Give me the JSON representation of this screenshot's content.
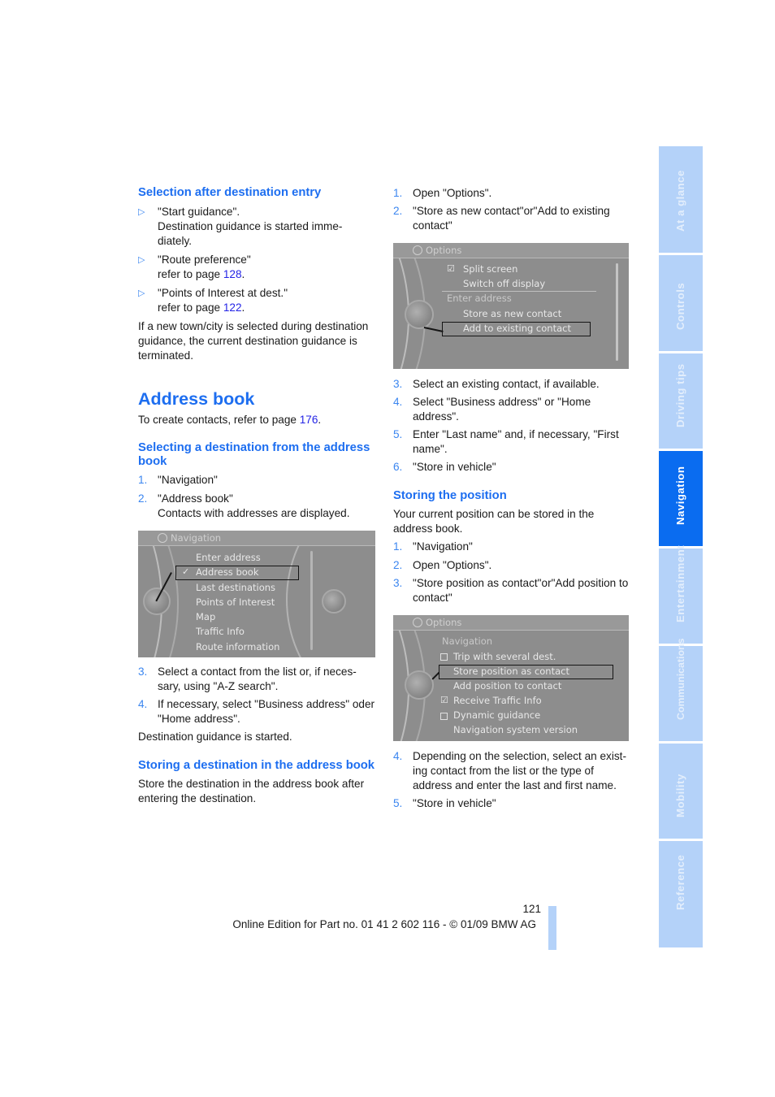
{
  "left_column": {
    "selection_heading": "Selection after destination entry",
    "bullets": [
      {
        "marker": "▷",
        "line1": "\"Start guidance\".",
        "line2": "Destination guidance is started imme-",
        "line3": "diately."
      },
      {
        "marker": "▷",
        "line1": "\"Route preference\"",
        "ref_prefix": "refer to page ",
        "ref_page": "128",
        "ref_suffix": "."
      },
      {
        "marker": "▷",
        "line1": "\"Points of Interest at dest.\"",
        "ref_prefix": "refer to page ",
        "ref_page": "122",
        "ref_suffix": "."
      }
    ],
    "selection_note": "If a new town/city is selected during destination guidance, the current destination guidance is terminated.",
    "address_book_title": "Address book",
    "create_contacts_prefix": "To create contacts, refer to page ",
    "create_contacts_page": "176",
    "create_contacts_suffix": ".",
    "selecting_heading": "Selecting a destination from the address book",
    "selecting_steps": [
      {
        "num": "1.",
        "text": "\"Navigation\""
      },
      {
        "num": "2.",
        "text": "\"Address book\"",
        "subtext": "Contacts with addresses are displayed."
      }
    ],
    "screen1": {
      "header": "Navigation",
      "items": [
        "Enter address",
        "Address book",
        "Last destinations",
        "Points of Interest",
        "Map",
        "Traffic Info",
        "Route information"
      ],
      "selected_index": 1,
      "check_mark": "✓"
    },
    "selecting_steps_2": [
      {
        "num": "3.",
        "text": "Select a contact from the list or, if neces-sary, using \"A-Z search\"."
      },
      {
        "num": "4.",
        "text": "If necessary, select \"Business address\" oder \"Home address\"."
      }
    ],
    "guidance_started": "Destination guidance is started.",
    "storing_dest_heading": "Storing a destination in the address book",
    "storing_dest_text": "Store the destination in the address book after entering the destination."
  },
  "right_column": {
    "steps_a": [
      {
        "num": "1.",
        "text": "Open \"Options\"."
      },
      {
        "num": "2.",
        "text": "\"Store as new contact\"or\"Add to existing contact\""
      }
    ],
    "screen2": {
      "header": "Options",
      "items": [
        {
          "label": "Split screen",
          "state": "checked"
        },
        {
          "label": "Switch off display"
        },
        {
          "label": "Enter address",
          "section": true
        },
        {
          "label": "Store as new contact"
        },
        {
          "label": "Add to existing contact",
          "selected": true
        }
      ]
    },
    "steps_b": [
      {
        "num": "3.",
        "text": "Select an existing contact, if available."
      },
      {
        "num": "4.",
        "text": "Select \"Business address\" or \"Home address\"."
      },
      {
        "num": "5.",
        "text": "Enter \"Last name\" and, if necessary, \"First name\"."
      },
      {
        "num": "6.",
        "text": "\"Store in vehicle\""
      }
    ],
    "storing_position_heading": "Storing the position",
    "storing_position_text": "Your current position can be stored in the address book.",
    "steps_c": [
      {
        "num": "1.",
        "text": "\"Navigation\""
      },
      {
        "num": "2.",
        "text": "Open \"Options\"."
      },
      {
        "num": "3.",
        "text": "\"Store position as contact\"or\"Add position to contact\""
      }
    ],
    "screen3": {
      "header": "Options",
      "items": [
        {
          "label": "Navigation",
          "section": true
        },
        {
          "label": "Trip with several dest.",
          "state": "unchecked"
        },
        {
          "label": "Store position as contact",
          "selected": true
        },
        {
          "label": "Add position to contact"
        },
        {
          "label": "Receive Traffic Info",
          "state": "checked"
        },
        {
          "label": "Dynamic guidance",
          "state": "unchecked"
        },
        {
          "label": "Navigation system version"
        }
      ]
    },
    "steps_d": [
      {
        "num": "4.",
        "text": "Depending on the selection, select an exist-ing contact from the list or the type of address and enter the last and first name."
      },
      {
        "num": "5.",
        "text": "\"Store in vehicle\""
      }
    ]
  },
  "side_tabs": [
    {
      "label": "At a glance",
      "active": false
    },
    {
      "label": "Controls",
      "active": false
    },
    {
      "label": "Driving tips",
      "active": false
    },
    {
      "label": "Navigation",
      "active": true
    },
    {
      "label": "Entertainment",
      "active": false
    },
    {
      "label": "Communications",
      "active": false
    },
    {
      "label": "Mobility",
      "active": false
    },
    {
      "label": "Reference",
      "active": false
    }
  ],
  "footer": {
    "page_number": "121",
    "edition": "Online Edition for Part no. 01 41 2 602 116 - © 01/09 BMW AG"
  },
  "colors": {
    "heading_blue": "#1d6ef0",
    "link_blue": "#2424e6",
    "tab_light": "#b4d2f9",
    "tab_active": "#0a6cf0",
    "screen_gray": "#8d8d8d"
  }
}
